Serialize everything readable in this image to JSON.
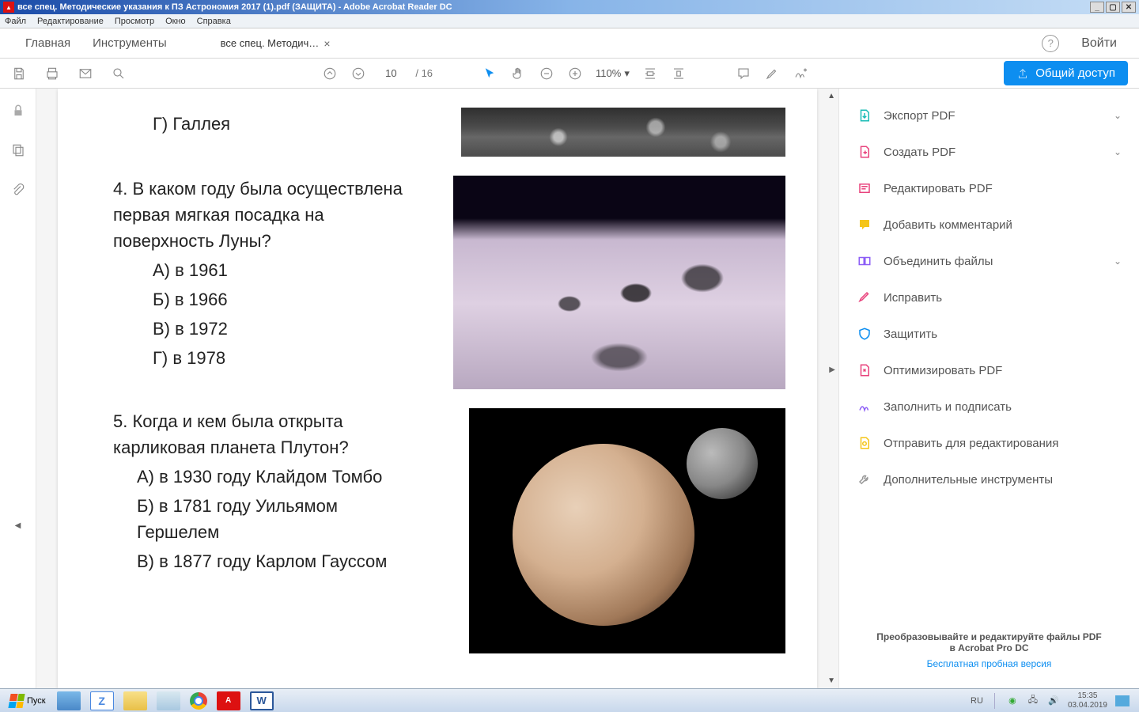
{
  "titlebar": {
    "title": "все спец. Методические указания к ПЗ Астрономия 2017 (1).pdf (ЗАЩИТА) - Adobe Acrobat Reader DC"
  },
  "menu": {
    "file": "Файл",
    "edit": "Редактирование",
    "view": "Просмотр",
    "window": "Окно",
    "help": "Справка"
  },
  "tabs": {
    "home": "Главная",
    "tools": "Инструменты",
    "doc": "все спец. Методич…",
    "login": "Войти"
  },
  "toolbar": {
    "page": "10",
    "total": "/  16",
    "zoom": "110%",
    "share": "Общий доступ"
  },
  "doc": {
    "q3opt": "Г) Галлея",
    "q4": "4. В каком году была осуществлена первая мягкая посадка на поверхность Луны?",
    "q4a": "А) в 1961",
    "q4b": "Б) в 1966",
    "q4c": "В) в 1972",
    "q4d": "Г) в 1978",
    "q5": "5. Когда и кем была открыта карликовая планета Плутон?",
    "q5a": "А) в 1930 году  Клайдом Томбо",
    "q5b": "Б) в 1781 году Уильямом Гершелем",
    "q5c": "В) в 1877 году Карлом Гауссом"
  },
  "right": {
    "export": "Экспорт PDF",
    "create": "Создать PDF",
    "edit": "Редактировать PDF",
    "comment": "Добавить комментарий",
    "combine": "Объединить файлы",
    "redact": "Исправить",
    "protect": "Защитить",
    "optimize": "Оптимизировать PDF",
    "fill": "Заполнить и подписать",
    "send": "Отправить для редактирования",
    "more": "Дополнительные инструменты",
    "footer1": "Преобразовывайте и редактируйте файлы PDF",
    "footer2": "в Acrobat Pro DC",
    "trial": "Бесплатная пробная версия"
  },
  "taskbar": {
    "start": "Пуск",
    "lang": "RU",
    "time": "15:35",
    "date": "03.04.2019"
  }
}
